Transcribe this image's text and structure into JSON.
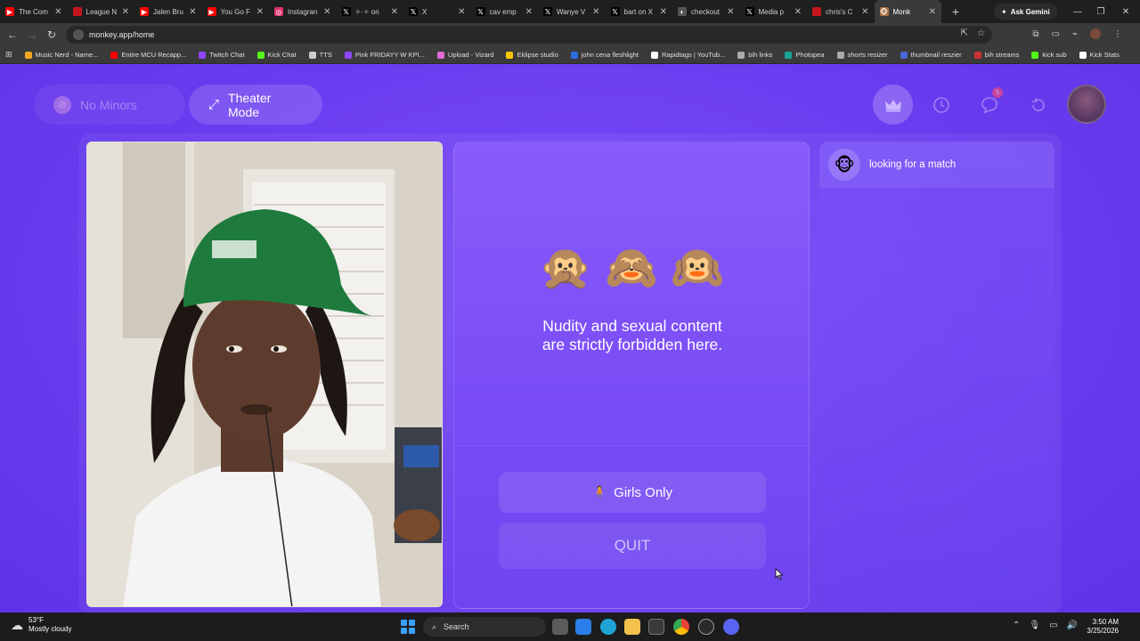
{
  "browser": {
    "tabs": [
      {
        "label": "The Com",
        "color": "#ff0000",
        "glyph": "▶"
      },
      {
        "label": "League N",
        "color": "#c4161c",
        "glyph": ""
      },
      {
        "label": "Jalen Bru",
        "color": "#ff0000",
        "glyph": "▶"
      },
      {
        "label": "You Go F",
        "color": "#ff0000",
        "glyph": "▶"
      },
      {
        "label": "Instagran",
        "color": "#e1306c",
        "glyph": "◎"
      },
      {
        "label": "✧·✧ on",
        "color": "#000000",
        "glyph": "𝕏"
      },
      {
        "label": "X",
        "color": "#000000",
        "glyph": "𝕏"
      },
      {
        "label": "cav emp",
        "color": "#000000",
        "glyph": "𝕏"
      },
      {
        "label": "Wanye V",
        "color": "#000000",
        "glyph": "𝕏"
      },
      {
        "label": "bart on X",
        "color": "#000000",
        "glyph": "𝕏"
      },
      {
        "label": "checkout",
        "color": "#555555",
        "glyph": "◐"
      },
      {
        "label": "Media p",
        "color": "#000000",
        "glyph": "𝕏"
      },
      {
        "label": "chris's C",
        "color": "#c4161c",
        "glyph": ""
      },
      {
        "label": "Monk",
        "color": "#a87040",
        "glyph": "🐵",
        "active": true
      }
    ],
    "new_tab": "+",
    "gemini_label": "Ask Gemini",
    "url": "monkey.app/home",
    "bookmarks": [
      {
        "label": "Music Nerd - Name...",
        "color": "#f5a623"
      },
      {
        "label": "Entire MCU Recapp...",
        "color": "#ff0000"
      },
      {
        "label": "Twitch Chat",
        "color": "#9146ff"
      },
      {
        "label": "Kick Chat",
        "color": "#53fc18"
      },
      {
        "label": "TTS",
        "color": "#cccccc"
      },
      {
        "label": "Pink FRIDAYY W KPI...",
        "color": "#9146ff"
      },
      {
        "label": "Upload - Vizard",
        "color": "#e06bd8"
      },
      {
        "label": "Eklipse studio",
        "color": "#f7c600"
      },
      {
        "label": "john cena fleshlight",
        "color": "#2d6cdf"
      },
      {
        "label": "Rapidtags | YouTub...",
        "color": "#ffffff"
      },
      {
        "label": "bih links",
        "color": "#aaaaaa"
      },
      {
        "label": "Photopea",
        "color": "#18a497"
      },
      {
        "label": "shorts resizer",
        "color": "#aaaaaa"
      },
      {
        "label": "thumbnail reszier",
        "color": "#4a67d6"
      },
      {
        "label": "bih streams",
        "color": "#cc3333"
      },
      {
        "label": "kick sub",
        "color": "#53fc18"
      },
      {
        "label": "Kick Stats",
        "color": "#ffffff"
      }
    ]
  },
  "app": {
    "no_minors_label": "No Minors",
    "theater_label": "Theater Mode",
    "notification_count": "5",
    "notice_line1": "Nudity and sexual content",
    "notice_line2": "are strictly forbidden here.",
    "monkeys": [
      "🙊",
      "🙈",
      "🙉"
    ],
    "girls_only_label": "Girls Only",
    "girls_only_icon": "🧍",
    "quit_label": "QUIT",
    "match_status": "looking for a match",
    "match_icon": "🐵"
  },
  "taskbar": {
    "temperature": "53°F",
    "weather": "Mostly cloudy",
    "search_label": "Search",
    "time": "3:50 AM",
    "date": "3/25/2026"
  },
  "colors": {
    "page_bg": "#6b3ef0",
    "panel": "#8a5bfa",
    "accent": "#c9b6ff"
  }
}
